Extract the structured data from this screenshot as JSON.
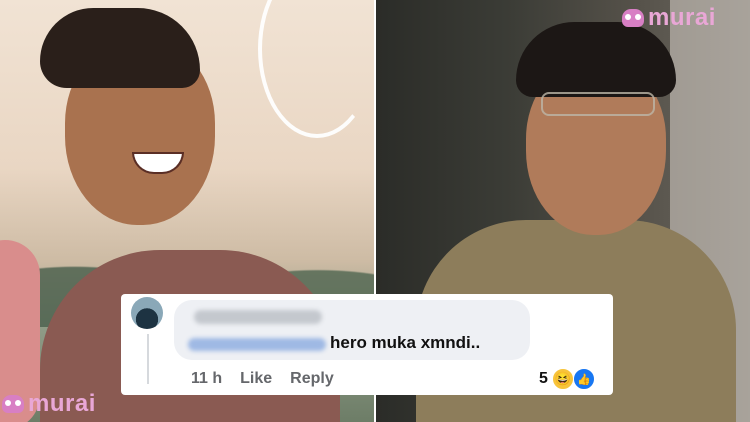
{
  "brand": {
    "watermark_text": "murai",
    "color": "#e9a7d6"
  },
  "comment": {
    "text": "hero muka xmndi..",
    "time": "11 h",
    "like_label": "Like",
    "reply_label": "Reply",
    "reaction_count": "5",
    "reaction_icons": [
      "haha-icon",
      "like-icon"
    ],
    "name_blurred": true,
    "mention_blurred": true
  },
  "colors": {
    "facebook_blue": "#1877f2",
    "bubble": "#eef0f4",
    "meta_text": "#65676b"
  }
}
